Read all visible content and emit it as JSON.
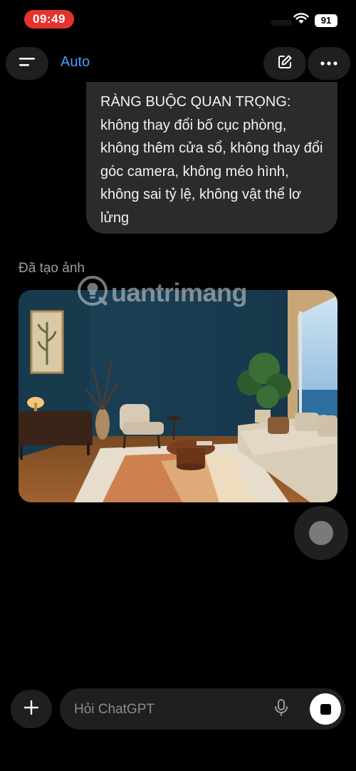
{
  "status_bar": {
    "time": "09:49",
    "battery": "91"
  },
  "header": {
    "model_label": "Auto"
  },
  "icons": {
    "menu": "menu-icon",
    "edit": "new-chat-icon",
    "more": "more-icon",
    "plus": "plus-icon",
    "mic": "mic-icon",
    "stop": "stop-icon",
    "wifi": "wifi-icon",
    "signal": "signal-icon"
  },
  "messages": {
    "user_text": "RÀNG BUỘC QUAN TRỌNG: không thay đổi bố cục phòng, không thêm cửa sổ, không thay đổi góc camera, không méo hình, không sai tỷ lệ, không vật thể lơ lửng",
    "assistant_label": "Đã tạo ảnh"
  },
  "watermark": {
    "text": "uantrimang"
  },
  "composer": {
    "placeholder": "Hỏi ChatGPT",
    "value": ""
  },
  "colors": {
    "accent": "#4a9cff",
    "status_time_bg": "#e5332f",
    "bubble": "#2b2b2b"
  }
}
